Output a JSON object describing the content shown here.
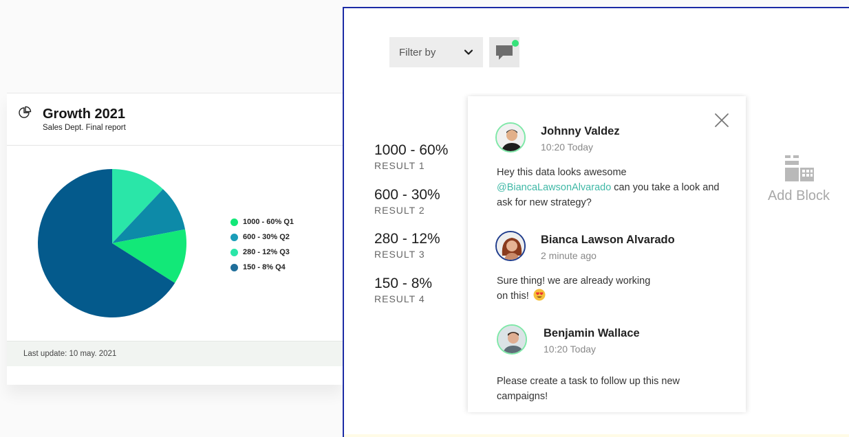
{
  "report": {
    "title": "Growth 2021",
    "subtitle": "Sales Dept. Final report",
    "last_update": "Last update: 10 may. 2021",
    "icon": "pie-chart-icon"
  },
  "chart_data": {
    "type": "pie",
    "values": [
      12,
      10,
      12,
      66
    ],
    "colors": [
      "#2ae6a8",
      "#0d8aa8",
      "#12e878",
      "#045a8c"
    ],
    "legend": [
      {
        "label": "1000 - 60% Q1",
        "color": "#12e878"
      },
      {
        "label": "600 - 30% Q2",
        "color": "#1a9db8"
      },
      {
        "label": "280 - 12% Q3",
        "color": "#2ae6a8"
      },
      {
        "label": "150 - 8% Q4",
        "color": "#1f6e9a"
      }
    ]
  },
  "toolbar": {
    "filter_label": "Filter by",
    "chat_indicator_color": "#36e27a"
  },
  "results": [
    {
      "value": "1000 - 60%",
      "label": "RESULT 1"
    },
    {
      "value": "600 - 30%",
      "label": "RESULT 2"
    },
    {
      "value": "280 - 12%",
      "label": "RESULT 3"
    },
    {
      "value": "150 - 8%",
      "label": "RESULT 4"
    }
  ],
  "comments": [
    {
      "author": "Johnny Valdez",
      "time": "10:20 Today",
      "mention": "@BiancaLawsonAlvarado",
      "text": " can you take a look and ask for new strategy?",
      "prefix": "Hey this data looks awesome",
      "ring": "#7fe8a8"
    },
    {
      "author": "Bianca Lawson Alvarado",
      "time": "2 minute ago",
      "text": "Sure thing! we are already working on this!",
      "ring": "#1f3c8c"
    },
    {
      "author": "Benjamin Wallace",
      "time": "10:20 Today",
      "text": "Please create a task to follow up this new campaigns!",
      "ring": "#7fe8a8"
    }
  ],
  "add_block": {
    "label": "Add Block"
  },
  "colors": {
    "accent_mention": "#3fb8a6",
    "panel_border": "#1b2ba5"
  }
}
